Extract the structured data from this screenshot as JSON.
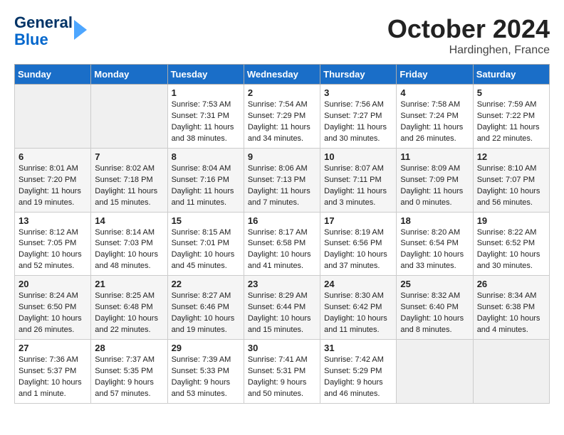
{
  "header": {
    "logo_line1": "General",
    "logo_line2": "Blue",
    "month": "October 2024",
    "location": "Hardinghen, France"
  },
  "days_of_week": [
    "Sunday",
    "Monday",
    "Tuesday",
    "Wednesday",
    "Thursday",
    "Friday",
    "Saturday"
  ],
  "weeks": [
    [
      {
        "day": "",
        "sunrise": "",
        "sunset": "",
        "daylight": ""
      },
      {
        "day": "",
        "sunrise": "",
        "sunset": "",
        "daylight": ""
      },
      {
        "day": "1",
        "sunrise": "Sunrise: 7:53 AM",
        "sunset": "Sunset: 7:31 PM",
        "daylight": "Daylight: 11 hours and 38 minutes."
      },
      {
        "day": "2",
        "sunrise": "Sunrise: 7:54 AM",
        "sunset": "Sunset: 7:29 PM",
        "daylight": "Daylight: 11 hours and 34 minutes."
      },
      {
        "day": "3",
        "sunrise": "Sunrise: 7:56 AM",
        "sunset": "Sunset: 7:27 PM",
        "daylight": "Daylight: 11 hours and 30 minutes."
      },
      {
        "day": "4",
        "sunrise": "Sunrise: 7:58 AM",
        "sunset": "Sunset: 7:24 PM",
        "daylight": "Daylight: 11 hours and 26 minutes."
      },
      {
        "day": "5",
        "sunrise": "Sunrise: 7:59 AM",
        "sunset": "Sunset: 7:22 PM",
        "daylight": "Daylight: 11 hours and 22 minutes."
      }
    ],
    [
      {
        "day": "6",
        "sunrise": "Sunrise: 8:01 AM",
        "sunset": "Sunset: 7:20 PM",
        "daylight": "Daylight: 11 hours and 19 minutes."
      },
      {
        "day": "7",
        "sunrise": "Sunrise: 8:02 AM",
        "sunset": "Sunset: 7:18 PM",
        "daylight": "Daylight: 11 hours and 15 minutes."
      },
      {
        "day": "8",
        "sunrise": "Sunrise: 8:04 AM",
        "sunset": "Sunset: 7:16 PM",
        "daylight": "Daylight: 11 hours and 11 minutes."
      },
      {
        "day": "9",
        "sunrise": "Sunrise: 8:06 AM",
        "sunset": "Sunset: 7:13 PM",
        "daylight": "Daylight: 11 hours and 7 minutes."
      },
      {
        "day": "10",
        "sunrise": "Sunrise: 8:07 AM",
        "sunset": "Sunset: 7:11 PM",
        "daylight": "Daylight: 11 hours and 3 minutes."
      },
      {
        "day": "11",
        "sunrise": "Sunrise: 8:09 AM",
        "sunset": "Sunset: 7:09 PM",
        "daylight": "Daylight: 11 hours and 0 minutes."
      },
      {
        "day": "12",
        "sunrise": "Sunrise: 8:10 AM",
        "sunset": "Sunset: 7:07 PM",
        "daylight": "Daylight: 10 hours and 56 minutes."
      }
    ],
    [
      {
        "day": "13",
        "sunrise": "Sunrise: 8:12 AM",
        "sunset": "Sunset: 7:05 PM",
        "daylight": "Daylight: 10 hours and 52 minutes."
      },
      {
        "day": "14",
        "sunrise": "Sunrise: 8:14 AM",
        "sunset": "Sunset: 7:03 PM",
        "daylight": "Daylight: 10 hours and 48 minutes."
      },
      {
        "day": "15",
        "sunrise": "Sunrise: 8:15 AM",
        "sunset": "Sunset: 7:01 PM",
        "daylight": "Daylight: 10 hours and 45 minutes."
      },
      {
        "day": "16",
        "sunrise": "Sunrise: 8:17 AM",
        "sunset": "Sunset: 6:58 PM",
        "daylight": "Daylight: 10 hours and 41 minutes."
      },
      {
        "day": "17",
        "sunrise": "Sunrise: 8:19 AM",
        "sunset": "Sunset: 6:56 PM",
        "daylight": "Daylight: 10 hours and 37 minutes."
      },
      {
        "day": "18",
        "sunrise": "Sunrise: 8:20 AM",
        "sunset": "Sunset: 6:54 PM",
        "daylight": "Daylight: 10 hours and 33 minutes."
      },
      {
        "day": "19",
        "sunrise": "Sunrise: 8:22 AM",
        "sunset": "Sunset: 6:52 PM",
        "daylight": "Daylight: 10 hours and 30 minutes."
      }
    ],
    [
      {
        "day": "20",
        "sunrise": "Sunrise: 8:24 AM",
        "sunset": "Sunset: 6:50 PM",
        "daylight": "Daylight: 10 hours and 26 minutes."
      },
      {
        "day": "21",
        "sunrise": "Sunrise: 8:25 AM",
        "sunset": "Sunset: 6:48 PM",
        "daylight": "Daylight: 10 hours and 22 minutes."
      },
      {
        "day": "22",
        "sunrise": "Sunrise: 8:27 AM",
        "sunset": "Sunset: 6:46 PM",
        "daylight": "Daylight: 10 hours and 19 minutes."
      },
      {
        "day": "23",
        "sunrise": "Sunrise: 8:29 AM",
        "sunset": "Sunset: 6:44 PM",
        "daylight": "Daylight: 10 hours and 15 minutes."
      },
      {
        "day": "24",
        "sunrise": "Sunrise: 8:30 AM",
        "sunset": "Sunset: 6:42 PM",
        "daylight": "Daylight: 10 hours and 11 minutes."
      },
      {
        "day": "25",
        "sunrise": "Sunrise: 8:32 AM",
        "sunset": "Sunset: 6:40 PM",
        "daylight": "Daylight: 10 hours and 8 minutes."
      },
      {
        "day": "26",
        "sunrise": "Sunrise: 8:34 AM",
        "sunset": "Sunset: 6:38 PM",
        "daylight": "Daylight: 10 hours and 4 minutes."
      }
    ],
    [
      {
        "day": "27",
        "sunrise": "Sunrise: 7:36 AM",
        "sunset": "Sunset: 5:37 PM",
        "daylight": "Daylight: 10 hours and 1 minute."
      },
      {
        "day": "28",
        "sunrise": "Sunrise: 7:37 AM",
        "sunset": "Sunset: 5:35 PM",
        "daylight": "Daylight: 9 hours and 57 minutes."
      },
      {
        "day": "29",
        "sunrise": "Sunrise: 7:39 AM",
        "sunset": "Sunset: 5:33 PM",
        "daylight": "Daylight: 9 hours and 53 minutes."
      },
      {
        "day": "30",
        "sunrise": "Sunrise: 7:41 AM",
        "sunset": "Sunset: 5:31 PM",
        "daylight": "Daylight: 9 hours and 50 minutes."
      },
      {
        "day": "31",
        "sunrise": "Sunrise: 7:42 AM",
        "sunset": "Sunset: 5:29 PM",
        "daylight": "Daylight: 9 hours and 46 minutes."
      },
      {
        "day": "",
        "sunrise": "",
        "sunset": "",
        "daylight": ""
      },
      {
        "day": "",
        "sunrise": "",
        "sunset": "",
        "daylight": ""
      }
    ]
  ]
}
